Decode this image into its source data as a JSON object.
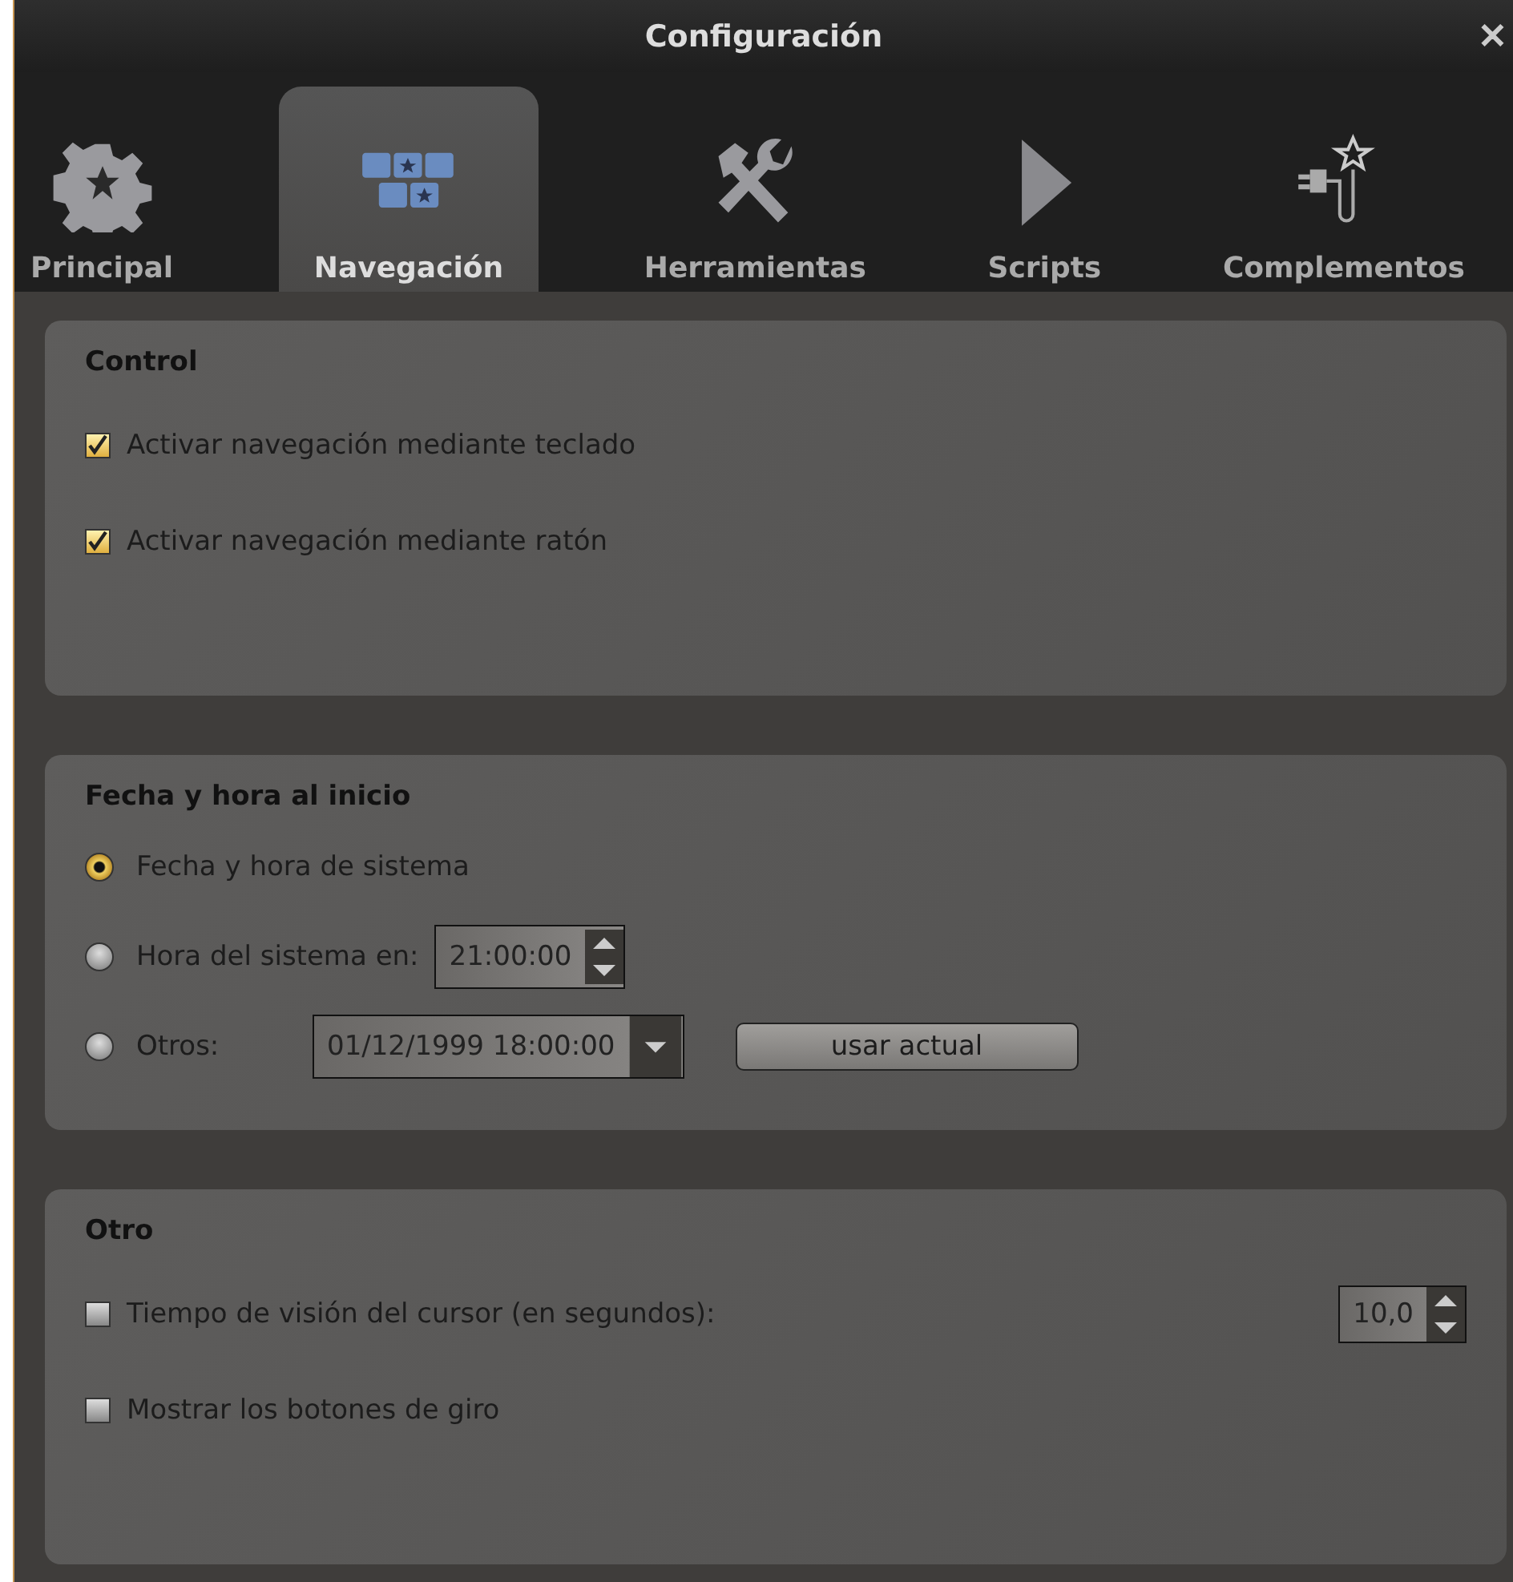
{
  "window": {
    "title": "Configuración",
    "close": "✕"
  },
  "tabs": [
    {
      "label": "Principal",
      "kind": "gear",
      "selected": false
    },
    {
      "label": "Navegación",
      "kind": "keys",
      "selected": true
    },
    {
      "label": "Herramientas",
      "kind": "tools",
      "selected": false
    },
    {
      "label": "Scripts",
      "kind": "play",
      "selected": false
    },
    {
      "label": "Complementos",
      "kind": "plugin",
      "selected": false
    }
  ],
  "sections": [
    {
      "title": "Control",
      "rows": [
        {
          "kind": "checkbox",
          "label": "Activar navegación mediante teclado",
          "checked": true
        },
        {
          "kind": "checkbox",
          "label": "Activar navegación mediante ratón",
          "checked": true
        }
      ]
    },
    {
      "title": "Fecha y hora al inicio",
      "rows": [
        {
          "kind": "radio",
          "label": "Fecha y hora de sistema",
          "selected": true
        },
        {
          "kind": "radio",
          "label": "Hora del sistema en:",
          "selected": false,
          "spinbox": "21:00:00"
        },
        {
          "kind": "radio",
          "label": "Otros:",
          "selected": false,
          "dropdown": "01/12/1999 18:00:00",
          "button": "usar actual"
        }
      ]
    },
    {
      "title": "Otro",
      "rows": [
        {
          "kind": "checkbox",
          "label": "Tiempo de visión del cursor (en segundos):",
          "checked": false,
          "spinbox": "10,0"
        },
        {
          "kind": "checkbox",
          "label": "Mostrar los botones de giro",
          "checked": false
        }
      ]
    }
  ]
}
